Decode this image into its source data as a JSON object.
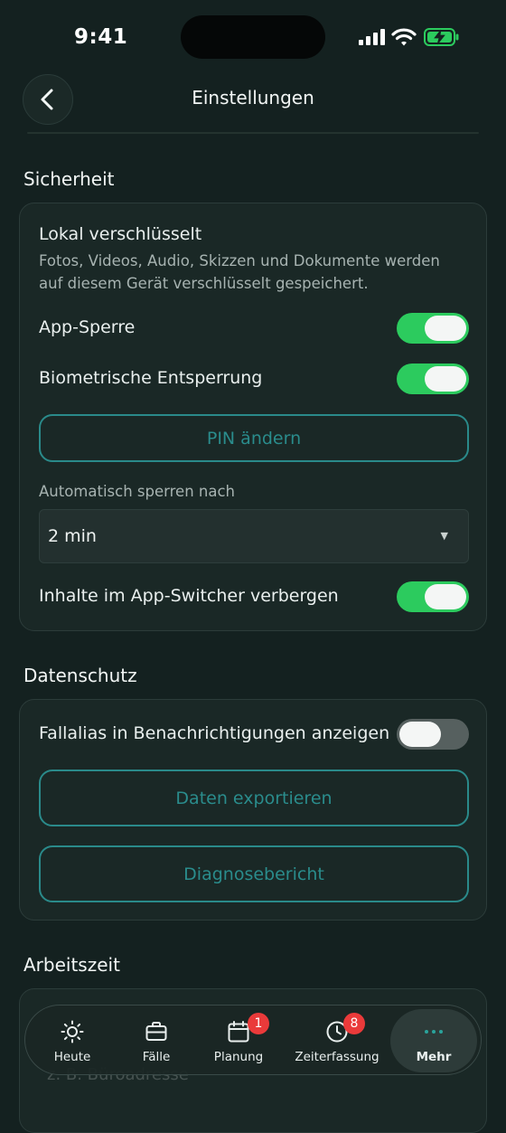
{
  "status_bar": {
    "time": "9:41"
  },
  "header": {
    "title": "Einstellungen"
  },
  "sections": {
    "security": {
      "title": "Sicherheit",
      "local_encrypted_title": "Lokal verschlüsselt",
      "local_encrypted_desc": "Fotos, Videos, Audio, Skizzen und Dokumente werden auf diesem Gerät verschlüsselt gespeichert.",
      "app_lock_label": "App-Sperre",
      "app_lock_on": true,
      "biometric_label": "Biometrische Entsperrung",
      "biometric_on": true,
      "change_pin_label": "PIN ändern",
      "auto_lock_label": "Automatisch sperren nach",
      "auto_lock_value": "2 min",
      "hide_switcher_label": "Inhalte im App-Switcher verbergen",
      "hide_switcher_on": true
    },
    "privacy": {
      "title": "Datenschutz",
      "show_alias_label": "Fallalias in Benachrichtigungen anzeigen",
      "show_alias_on": false,
      "export_label": "Daten exportieren",
      "diagnostics_label": "Diagnosebericht"
    },
    "worktime": {
      "title": "Arbeitszeit",
      "placeholder": "z. B. Büroadresse"
    }
  },
  "tabbar": {
    "items": [
      {
        "label": "Heute",
        "icon": "sun-icon"
      },
      {
        "label": "Fälle",
        "icon": "briefcase-icon"
      },
      {
        "label": "Planung",
        "icon": "calendar-icon",
        "badge": "1"
      },
      {
        "label": "Zeiterfassung",
        "icon": "clock-icon",
        "badge": "8"
      },
      {
        "label": "Mehr",
        "icon": "more-dots-icon",
        "active": true
      }
    ]
  },
  "colors": {
    "accent": "#2a8c8c",
    "toggle_on": "#2ccb5e",
    "badge": "#ea3a3a",
    "background": "#142120"
  }
}
